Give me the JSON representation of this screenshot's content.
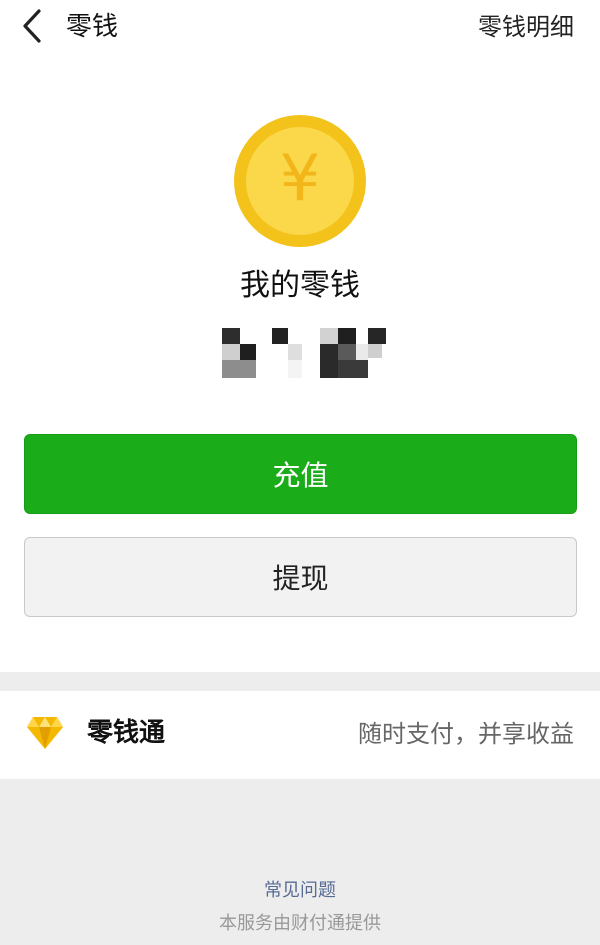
{
  "navbar": {
    "back_icon": "chevron-left-icon",
    "title": "零钱",
    "details_link": "零钱明细"
  },
  "wallet": {
    "coin_icon": "yuan-coin-icon",
    "coin_symbol": "¥",
    "title": "我的零钱",
    "balance_note": "pixelated / hidden balance"
  },
  "actions": {
    "recharge_label": "充值",
    "withdraw_label": "提现"
  },
  "lingqiantong": {
    "icon": "diamond-icon",
    "label": "零钱通",
    "description": "随时支付，并享收益"
  },
  "footer": {
    "faq_link": "常见问题",
    "provider_text": "本服务由财付通提供"
  },
  "colors": {
    "primary_green": "#1aad19",
    "coin_gold": "#f3c21b",
    "link_blue": "#576b95",
    "background": "#ededed"
  }
}
